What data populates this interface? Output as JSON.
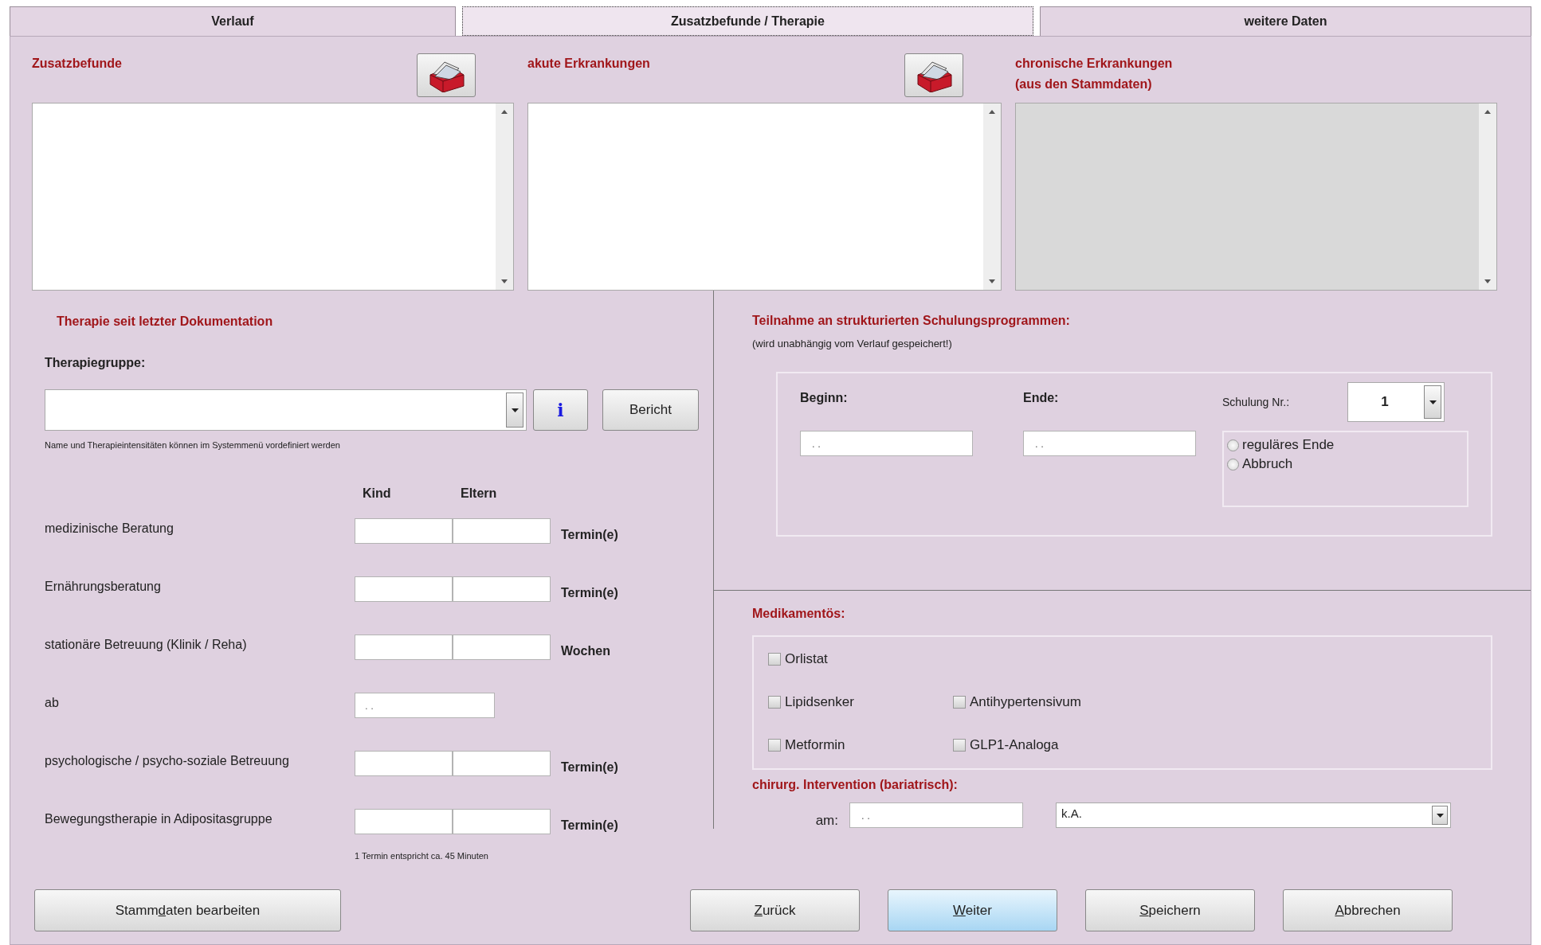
{
  "tabs": [
    {
      "label": "Verlauf",
      "selected": false
    },
    {
      "label": "Zusatzbefunde / Therapie",
      "selected": true
    },
    {
      "label": "weitere Daten",
      "selected": false
    }
  ],
  "lists": [
    {
      "title": "Zusatzbefunde",
      "has_button": true,
      "disabled": false
    },
    {
      "title": "akute Erkrankungen",
      "has_button": true,
      "disabled": false
    },
    {
      "title": "chronische Erkrankungen\n(aus den Stammdaten)",
      "has_button": false,
      "disabled": true
    }
  ],
  "therapy": {
    "title": "Therapie seit letzter Dokumentation",
    "group_label": "Therapiegruppe:",
    "info_button": "i",
    "report_button": "Bericht",
    "hint": "Name und Therapieintensitäten können im Systemmenü vordefiniert werden",
    "columns": [
      "Kind",
      "Eltern"
    ],
    "rows": [
      {
        "label": "medizinische Beratung",
        "kind": "pair",
        "unit": "Termin(e)"
      },
      {
        "label": "Ernährungsberatung",
        "kind": "pair",
        "unit": "Termin(e)"
      },
      {
        "label": "stationäre Betreuung (Klinik / Reha)",
        "kind": "pair",
        "unit": "Wochen"
      },
      {
        "label": "ab",
        "kind": "date",
        "value": ". ."
      },
      {
        "label": "psychologische / psycho-soziale Betreuung",
        "kind": "pair",
        "unit": "Termin(e)"
      },
      {
        "label": "Bewegungstherapie in Adipositasgruppe",
        "kind": "pair",
        "unit": "Termin(e)"
      }
    ],
    "footnote": "1 Termin entspricht ca. 45 Minuten"
  },
  "training": {
    "title": "Teilnahme an strukturierten Schulungsprogrammen:",
    "note": "(wird unabhängig vom Verlauf gespeichert!)",
    "begin": {
      "label": "Beginn:",
      "value": ". ."
    },
    "end": {
      "label": "Ende:",
      "value": ". ."
    },
    "number": {
      "label": "Schulung Nr.:",
      "value": "1"
    },
    "outcomes": [
      {
        "label": "reguläres Ende",
        "selected": false
      },
      {
        "label": "Abbruch",
        "selected": false
      }
    ]
  },
  "medication": {
    "title": "Medikamentös:",
    "rows": [
      [
        {
          "label": "Orlistat",
          "checked": false
        }
      ],
      [
        {
          "label": "Lipidsenker",
          "checked": false
        },
        {
          "label": "Antihypertensivum",
          "checked": false
        }
      ],
      [
        {
          "label": "Metformin",
          "checked": false
        },
        {
          "label": "GLP1-Analoga",
          "checked": false
        }
      ]
    ]
  },
  "surgery": {
    "title": "chirurg. Intervention (bariatrisch):",
    "date_label": "am:",
    "date_value": ". .",
    "type_value": "k.A."
  },
  "footer": {
    "left_buttons": [
      {
        "pre": "Stamm",
        "access_key": "d",
        "post": "aten bearbeiten",
        "default": false
      }
    ],
    "right_buttons": [
      {
        "access_key": "Z",
        "post": "urück",
        "default": false
      },
      {
        "access_key": "W",
        "post": "eiter",
        "default": true
      },
      {
        "access_key": "S",
        "post": "peichern",
        "default": false
      },
      {
        "access_key": "A",
        "post": "bbrechen",
        "default": false
      }
    ]
  }
}
